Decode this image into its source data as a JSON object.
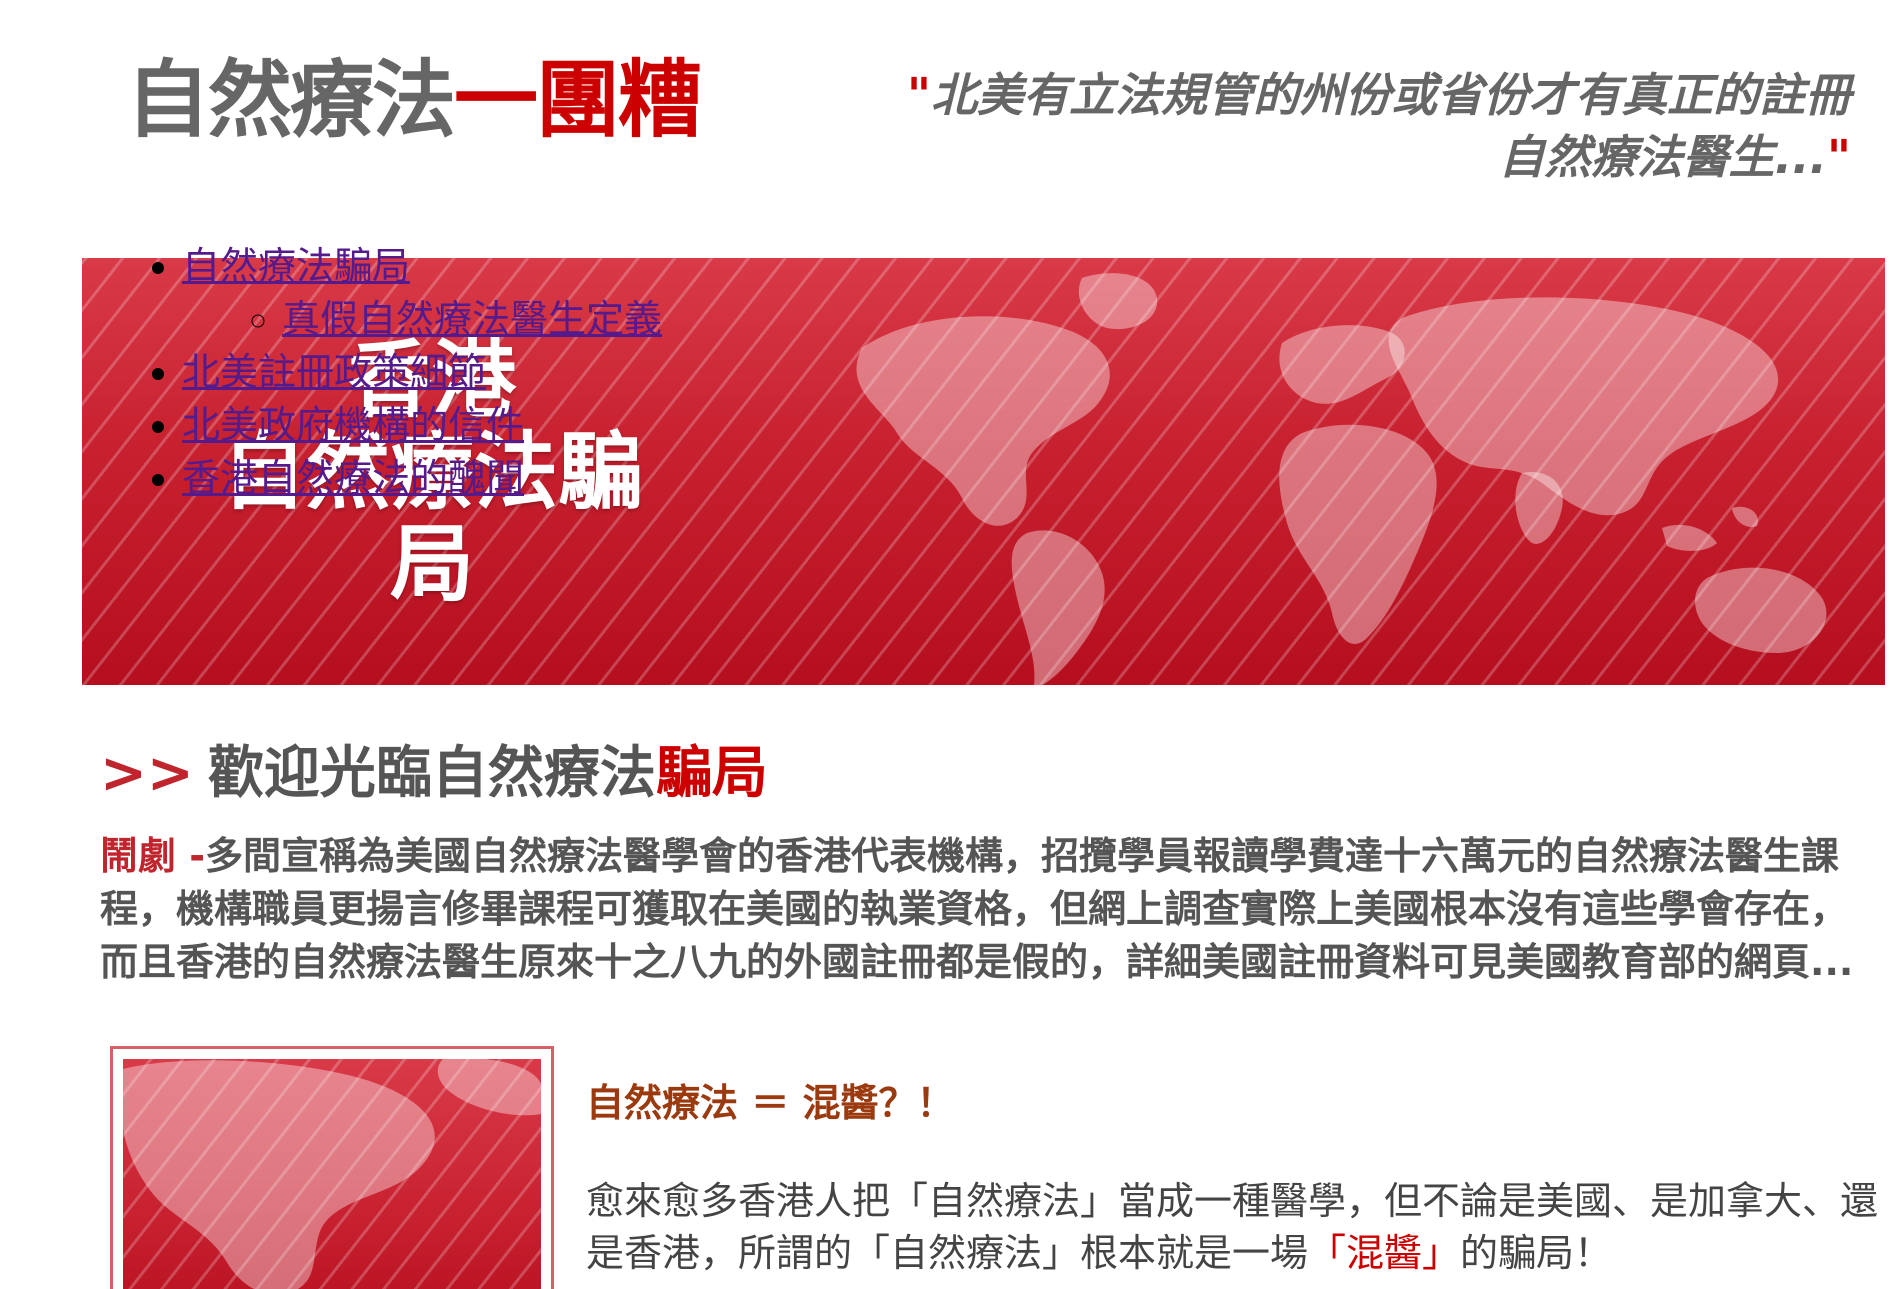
{
  "header": {
    "title_part1": "自然療法",
    "title_part2": "一團糟",
    "tagline_open_quote": "\"",
    "tagline_line1": "北美有立法規管的州份或省份才有真正的註冊",
    "tagline_line2": "自然療法醫生...",
    "tagline_close_quote": "\""
  },
  "banner": {
    "title_line1": "香港",
    "title_line2": "自然療法騙局"
  },
  "nav": {
    "items": [
      {
        "label": "自然療法騙局"
      },
      {
        "label": "北美註冊政策細節"
      },
      {
        "label": "北美政府機構的信件"
      },
      {
        "label": "香港自然療法的醜聞"
      }
    ],
    "subitems": [
      {
        "label": "真假自然療法醫生定義"
      }
    ]
  },
  "welcome": {
    "arrows": ">>",
    "heading_main": "歡迎光臨自然療法",
    "heading_red": "騙局",
    "intro_lead": "鬧劇 -",
    "intro_text": "多間宣稱為美國自然療法醫學會的香港代表機構，招攬學員報讀學費達十六萬元的自然療法醫生課程，機構職員更揚言修畢課程可獲取在美國的執業資格，但網上調查實際上美國根本沒有這些學會存在，而且香港的自然療法醫生原來十之八九的外國註冊都是假的，詳細美國註冊資料可見美國教育部的網頁..."
  },
  "article": {
    "heading": "自然療法 ＝ 混醬？！",
    "body_part1": "愈來愈多香港人把「自然療法」當成一種醫學，但不論是美國、是加拿大、還是香港，所謂的「自然療法」根本就是一場",
    "body_red": "「混醬」",
    "body_part2": "的騙局！"
  },
  "colors": {
    "brand_red": "#cc0000",
    "banner_red": "#c7202f",
    "text_grey": "#666666",
    "heading_brown": "#9b3a0f",
    "link_visited": "#551a8b"
  }
}
